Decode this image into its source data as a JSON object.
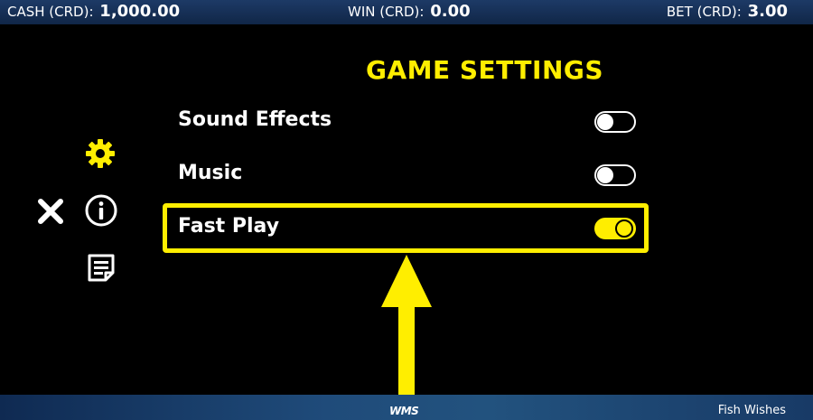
{
  "status": {
    "cash_label": "CASH (CRD):",
    "cash_value": "1,000.00",
    "win_label": "WIN (CRD):",
    "win_value": "0.00",
    "bet_label": "BET (CRD):",
    "bet_value": "3.00"
  },
  "settings": {
    "title": "GAME SETTINGS",
    "options": [
      {
        "label": "Sound Effects",
        "enabled": false
      },
      {
        "label": "Music",
        "enabled": false
      },
      {
        "label": "Fast Play",
        "enabled": true
      }
    ]
  },
  "side_menu": {
    "icons": [
      "gear-icon",
      "close-icon",
      "info-icon",
      "paytable-icon"
    ]
  },
  "footer": {
    "logo": "WMS",
    "game_name": "Fish Wishes"
  },
  "colors": {
    "accent": "#ffee00",
    "background": "#000000",
    "topbar": "#153159"
  }
}
